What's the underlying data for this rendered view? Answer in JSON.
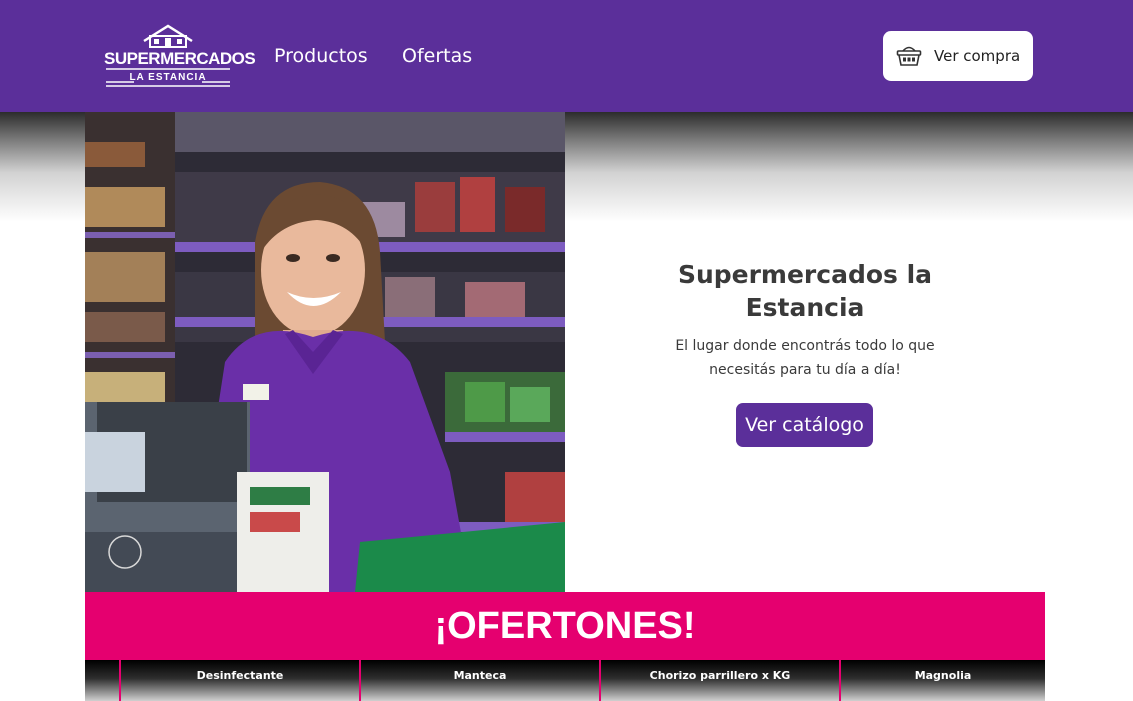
{
  "brand": {
    "name": "SUPERMERCADOS",
    "sub": "LA ESTANCIA",
    "color": "#5b2f9a",
    "accent": "#e5006f"
  },
  "nav": {
    "items": [
      {
        "label": "Productos"
      },
      {
        "label": "Ofertas"
      }
    ],
    "cart": {
      "label": "Ver compra",
      "icon": "basket-icon"
    }
  },
  "hero": {
    "title": "Supermercados la Estancia",
    "subtitle": "El lugar donde encontrás todo lo que necesitás para tu día a día!",
    "cta": "Ver catálogo",
    "image": "cashier-photo"
  },
  "offers": {
    "title": "¡OFERTONES!",
    "items": [
      {
        "name": "Desinfectante"
      },
      {
        "name": "Manteca"
      },
      {
        "name": "Chorizo parrillero x KG"
      },
      {
        "name": "Magnolia"
      }
    ]
  }
}
